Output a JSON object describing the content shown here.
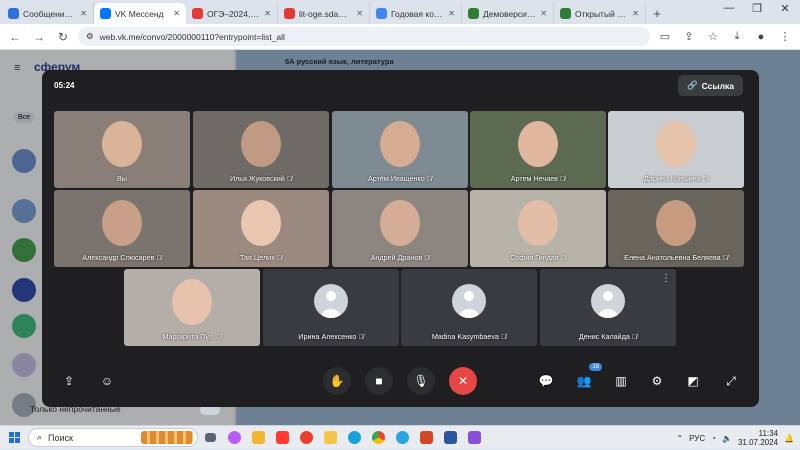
{
  "browser": {
    "tabs": [
      {
        "label": "Сообщения — С",
        "color": "#2f6fe0",
        "active": false
      },
      {
        "label": "VK Мессенд",
        "color": "#0077ff",
        "active": true
      },
      {
        "label": "ОГЭ–2024, лите",
        "color": "#e53935",
        "active": false
      },
      {
        "label": "lit-oge.sdamgia",
        "color": "#e53935",
        "active": false
      },
      {
        "label": "Годовая контро",
        "color": "#4285f4",
        "active": false
      },
      {
        "label": "Демоверсии, сп",
        "color": "#2e7d32",
        "active": false
      },
      {
        "label": "Открытый бан",
        "color": "#2e7d32",
        "active": false
      }
    ],
    "url": "web.vk.me/convo/2000000110?entrypoint=list_all"
  },
  "vk": {
    "logo": "сферум",
    "chat_title": "5А русский язык, литература",
    "filter_all": "Все",
    "unread_only": "Только непрочитанные"
  },
  "call": {
    "timer": "05:24",
    "link_button": "Ссылка",
    "participants_badge": "18",
    "participants": [
      {
        "name": "Вы",
        "muted": false,
        "video": true,
        "bg": "#8a7f78",
        "face": "#d9b49a"
      },
      {
        "name": "Илья Жуковский",
        "muted": true,
        "video": true,
        "bg": "#6e6a66",
        "face": "#c19a86"
      },
      {
        "name": "Артём Иващенко",
        "muted": true,
        "video": true,
        "bg": "#7f8b93",
        "face": "#d6ac92"
      },
      {
        "name": "Артем Нечаев",
        "muted": true,
        "video": true,
        "bg": "#5d6a52",
        "face": "#e0b79d"
      },
      {
        "name": "Дарина Коншина",
        "muted": true,
        "video": true,
        "bg": "#c9ccd1",
        "face": "#e6c4ab"
      },
      {
        "name": "Александр Слюсарев",
        "muted": true,
        "video": true,
        "bg": "#7b746e",
        "face": "#c89f88"
      },
      {
        "name": "Тая Целих",
        "muted": true,
        "video": true,
        "bg": "#9b8a80",
        "face": "#e8c6b0"
      },
      {
        "name": "Андрей Дранов",
        "muted": true,
        "video": true,
        "bg": "#8d8680",
        "face": "#d5ad96"
      },
      {
        "name": "София Гиндая",
        "muted": true,
        "video": true,
        "bg": "#b8b3a9",
        "face": "#e2bea6"
      },
      {
        "name": "Елена Анатольевна Беляева",
        "muted": true,
        "video": true,
        "bg": "#68655c",
        "face": "#c69b80"
      },
      {
        "name": "Маргарита Пу...",
        "muted": true,
        "video": true,
        "bg": "#b4aea8",
        "face": "#e7c2ad"
      },
      {
        "name": "Ирина Алексенко",
        "muted": true,
        "video": false,
        "bg": "#3a3b40"
      },
      {
        "name": "Madina Kasymbaeva",
        "muted": true,
        "video": false,
        "bg": "#3a3b40"
      },
      {
        "name": "Денис Калайда",
        "muted": true,
        "video": false,
        "bg": "#3a3b40"
      }
    ]
  },
  "taskbar": {
    "search_placeholder": "Поиск",
    "lang": "РУС",
    "time": "11:34",
    "date": "31.07.2024"
  }
}
